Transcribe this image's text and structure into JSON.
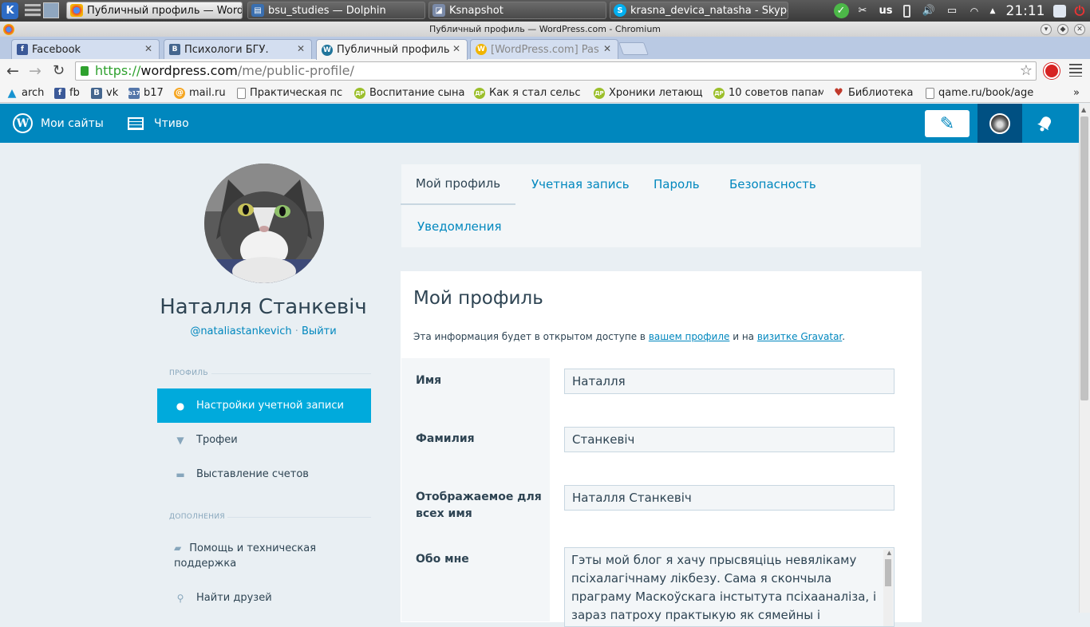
{
  "panel": {
    "tasks": [
      {
        "label": "Публичный профиль — WordPr",
        "icon": "chromium-icon"
      },
      {
        "label": "bsu_studies — Dolphin",
        "icon": "dolphin-icon"
      },
      {
        "label": "Ksnapshot",
        "icon": "ksnapshot-icon"
      },
      {
        "label": "krasna_devica_natasha - Skype",
        "icon": "skype-icon"
      }
    ],
    "keyboard_layout": "us",
    "clock": "21:11"
  },
  "window": {
    "title": "Публичный профиль — WordPress.com - Chromium"
  },
  "browser": {
    "tabs": [
      {
        "label": "Facebook",
        "icon": "facebook-icon"
      },
      {
        "label": "Психологи БГУ.",
        "icon": "vk-icon"
      },
      {
        "label": "Публичный профиль",
        "icon": "wordpress-icon"
      },
      {
        "label": "[WordPress.com] Pas",
        "icon": "wordpress-icon"
      }
    ],
    "url_scheme": "https://",
    "url_host": "wordpress.com",
    "url_path": "/me/public-profile/",
    "bookmarks": [
      {
        "label": "arch",
        "icon": "arch-icon"
      },
      {
        "label": "fb",
        "icon": "facebook-icon"
      },
      {
        "label": "vk",
        "icon": "vk-icon"
      },
      {
        "label": "b17",
        "icon": "b17-icon"
      },
      {
        "label": "mail.ru",
        "icon": "mailru-icon"
      },
      {
        "label": "Практическая пс",
        "icon": "page-icon"
      },
      {
        "label": "Воспитание сына",
        "icon": "dr-icon"
      },
      {
        "label": "Как я стал сельс",
        "icon": "dr-icon"
      },
      {
        "label": "Хроники летающ",
        "icon": "dr-icon"
      },
      {
        "label": "10 советов папам",
        "icon": "dr-icon"
      },
      {
        "label": "Библиотека",
        "icon": "heart-icon"
      },
      {
        "label": "qame.ru/book/age",
        "icon": "page-icon"
      }
    ],
    "more": "»"
  },
  "masterbar": {
    "my_sites": "Мои сайты",
    "reader": "Чтиво"
  },
  "profile": {
    "name": "Наталля Станкевіч",
    "username": "@nataliastankevich",
    "separator": " · ",
    "logout": "Выйти"
  },
  "sidebar": {
    "section1": "ПРОФИЛЬ",
    "items1": [
      {
        "label": "Настройки учетной записи",
        "icon": "user-icon"
      },
      {
        "label": "Трофеи",
        "icon": "trophy-icon"
      },
      {
        "label": "Выставление счетов",
        "icon": "credit-card-icon"
      }
    ],
    "section2": "ДОПОЛНЕНИЯ",
    "items2": [
      {
        "label": "Помощь и техническая поддержка",
        "icon": "chat-icon"
      },
      {
        "label": "Найти друзей",
        "icon": "search-icon"
      }
    ]
  },
  "nav_tabs": [
    "Мой профиль",
    "Учетная запись",
    "Пароль",
    "Безопасность",
    "Уведомления"
  ],
  "form": {
    "heading": "Мой профиль",
    "intro_before": "Эта информация будет в открытом доступе в ",
    "intro_link1": "вашем профиле",
    "intro_middle": " и на ",
    "intro_link2": "визитке Gravatar",
    "intro_after": ".",
    "first_name_label": "Имя",
    "first_name_value": "Наталля",
    "last_name_label": "Фамилия",
    "last_name_value": "Станкевіч",
    "display_name_label_1": "Отображаемое для",
    "display_name_label_2": "всех имя",
    "display_name_value": "Наталля Станкевіч",
    "about_label": "Обо мне",
    "about_value": "Гэты мой блог я хачу прысвяціць невялікаму псіхалагічнаму лікбезу. Сама я скончыла праграму Маскоўскага інстытута псіхааналіза, і зараз патроху практыкую як сямейны і індывідуальны"
  },
  "colors": {
    "wp_blue": "#0087be",
    "active_item": "#00aadc",
    "text": "#2e4453",
    "background": "#e9eff3"
  }
}
